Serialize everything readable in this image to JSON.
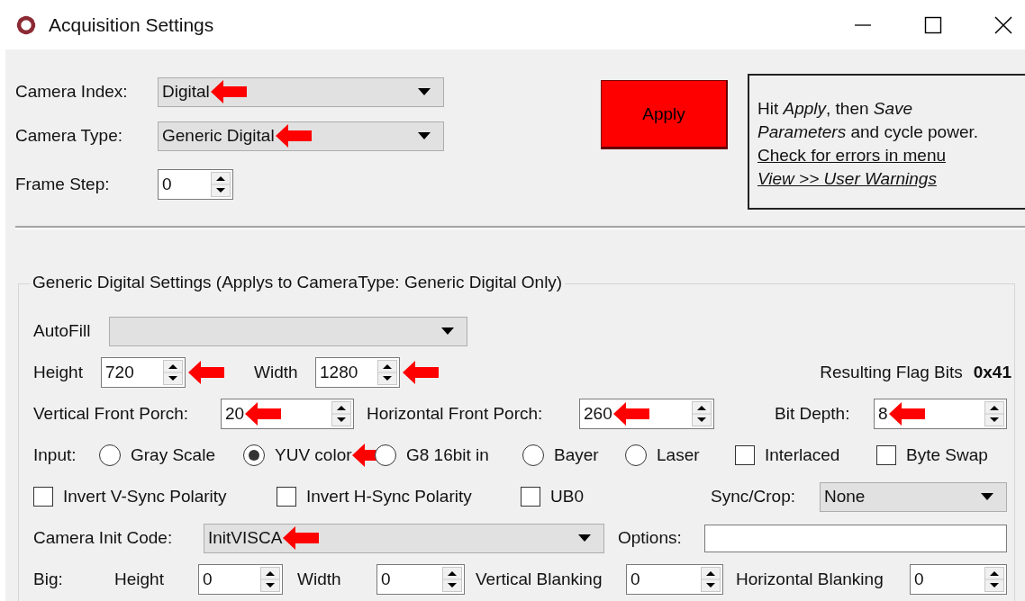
{
  "window": {
    "title": "Acquisition Settings"
  },
  "camera_index": {
    "label": "Camera Index:",
    "value": "Digital",
    "arrow": true
  },
  "camera_type": {
    "label": "Camera Type:",
    "value": "Generic Digital",
    "arrow": true
  },
  "frame_step": {
    "label": "Frame Step:",
    "value": "0"
  },
  "apply_button": {
    "label": "Apply"
  },
  "note": {
    "text": "Hit *Apply*, then *Save Parameters* and cycle power.",
    "links": [
      "Check for errors in menu",
      "View >> User Warnings"
    ]
  },
  "group": {
    "title": "Generic Digital Settings (Applys to CameraType: Generic Digital Only)",
    "autofill": {
      "label": "AutoFill"
    },
    "height": {
      "label": "Height",
      "value": "720",
      "arrow": true
    },
    "width": {
      "label": "Width",
      "value": "1280",
      "arrow": true
    },
    "flag_bits": {
      "label": "Resulting Flag Bits",
      "value": "0x41"
    },
    "vertical_front_porch": {
      "label": "Vertical Front Porch:",
      "value": "20",
      "arrow": true
    },
    "horizontal_front_porch": {
      "label": "Horizontal Front Porch:",
      "value": "260",
      "arrow": true
    },
    "bit_depth": {
      "label": "Bit Depth:",
      "value": "8",
      "arrow": true
    },
    "input": {
      "label": "Input:",
      "options": [
        {
          "label": "Gray Scale",
          "selected": false
        },
        {
          "label": "YUV color",
          "selected": true,
          "arrow": true
        },
        {
          "label": "G8 16bit in",
          "selected": false
        },
        {
          "label": "Bayer",
          "selected": false
        },
        {
          "label": "Laser",
          "selected": false
        }
      ]
    },
    "flags": [
      {
        "label": "Interlaced",
        "checked": false
      },
      {
        "label": "Byte Swap",
        "checked": false
      }
    ],
    "sync_flags": [
      {
        "label": "Invert V-Sync Polarity",
        "checked": false
      },
      {
        "label": "Invert H-Sync Polarity",
        "checked": false
      },
      {
        "label": "UB0",
        "checked": false
      }
    ],
    "sync_crop": {
      "label": "Sync/Crop:",
      "value": "None"
    },
    "init_code": {
      "label": "Camera Init Code:",
      "value": "InitVISCA",
      "arrow": true
    },
    "options": {
      "label": "Options:"
    },
    "big": {
      "label": "Big:",
      "fields": [
        {
          "label": "Height",
          "value": "0"
        },
        {
          "label": "Width",
          "value": "0"
        },
        {
          "label": "Vertical Blanking",
          "value": "0"
        },
        {
          "label": "Horizontal Blanking",
          "value": "0"
        }
      ]
    }
  }
}
